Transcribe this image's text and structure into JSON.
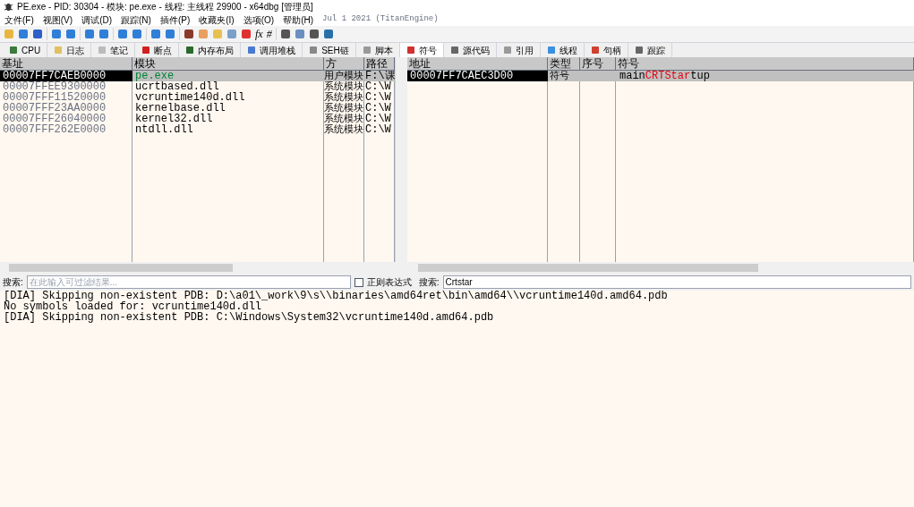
{
  "window": {
    "title": "PE.exe - PID: 30304 - 模块: pe.exe - 线程: 主线程 29900 - x64dbg [管理员]"
  },
  "menu": [
    "文件(F)",
    "视图(V)",
    "调试(D)",
    "跟踪(N)",
    "插件(P)",
    "收藏夹(I)",
    "选项(O)",
    "帮助(H)"
  ],
  "build_info": "Jul 1 2021 (TitanEngine)",
  "toolbar_glyphs": [
    "fx",
    "#"
  ],
  "tabs": [
    {
      "label": "CPU",
      "selected": false
    },
    {
      "label": "日志",
      "selected": false
    },
    {
      "label": "笔记",
      "selected": false
    },
    {
      "label": "断点",
      "selected": false
    },
    {
      "label": "内存布局",
      "selected": false
    },
    {
      "label": "调用堆栈",
      "selected": false
    },
    {
      "label": "SEH链",
      "selected": false
    },
    {
      "label": "脚本",
      "selected": false
    },
    {
      "label": "符号",
      "selected": true
    },
    {
      "label": "源代码",
      "selected": false
    },
    {
      "label": "引用",
      "selected": false
    },
    {
      "label": "线程",
      "selected": false
    },
    {
      "label": "句柄",
      "selected": false
    },
    {
      "label": "跟踪",
      "selected": false
    }
  ],
  "modules": {
    "columns": [
      "基址",
      "模块",
      "方",
      "路径"
    ],
    "rows": [
      {
        "base": "00007FF7CAEB0000",
        "module": "pe.exe",
        "type": "用户模块",
        "path": "F:\\课",
        "selected": true,
        "user": true
      },
      {
        "base": "00007FFEE9300000",
        "module": "ucrtbased.dll",
        "type": "系统模块",
        "path": "C:\\W",
        "selected": false,
        "user": false
      },
      {
        "base": "00007FFF11520000",
        "module": "vcruntime140d.dll",
        "type": "系统模块",
        "path": "C:\\W",
        "selected": false,
        "user": false
      },
      {
        "base": "00007FFF23AA0000",
        "module": "kernelbase.dll",
        "type": "系统模块",
        "path": "C:\\W",
        "selected": false,
        "user": false
      },
      {
        "base": "00007FFF26040000",
        "module": "kernel32.dll",
        "type": "系统模块",
        "path": "C:\\W",
        "selected": false,
        "user": false
      },
      {
        "base": "00007FFF262E0000",
        "module": "ntdll.dll",
        "type": "系统模块",
        "path": "C:\\W",
        "selected": false,
        "user": false
      }
    ]
  },
  "symbols": {
    "columns": [
      "地址",
      "类型",
      "序号",
      "符号"
    ],
    "rows": [
      {
        "address": "00007FF7CAEC3D00",
        "type": "符号",
        "selected": true,
        "symbol": [
          {
            "text": "main",
            "match": false
          },
          {
            "text": "CRTStar",
            "match": true
          },
          {
            "text": "tup",
            "match": false
          }
        ]
      }
    ]
  },
  "left_search": {
    "label": "搜索:",
    "placeholder": "在此输入可过滤结果..."
  },
  "regex": {
    "label": "正则表达式",
    "checked": false
  },
  "right_search": {
    "label": "搜索:",
    "value": "Crtstar"
  },
  "log": [
    "[DIA] Skipping non-existent PDB: D:\\a01\\_work\\9\\s\\\\binaries\\amd64ret\\bin\\amd64\\\\vcruntime140d.amd64.pdb",
    "No symbols loaded for: vcruntime140d.dll",
    "[DIA] Skipping non-existent PDB: C:\\Windows\\System32\\vcruntime140d.amd64.pdb"
  ]
}
